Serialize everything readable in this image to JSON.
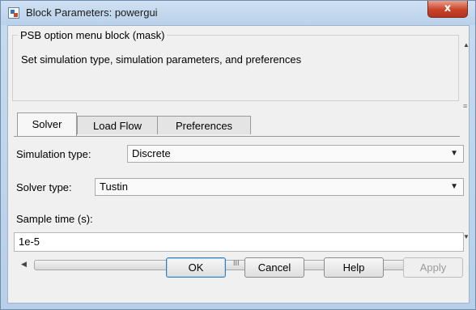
{
  "window": {
    "title": "Block Parameters: powergui",
    "close_label": "x"
  },
  "mask": {
    "legend": "PSB option menu block (mask)",
    "description": "Set simulation type, simulation parameters, and preferences"
  },
  "tabs": [
    {
      "label": "Solver",
      "active": true
    },
    {
      "label": "Load Flow",
      "active": false
    },
    {
      "label": "Preferences",
      "active": false
    }
  ],
  "solver": {
    "simulation_type_label": "Simulation type:",
    "simulation_type_value": "Discrete",
    "solver_type_label": "Solver type:",
    "solver_type_value": "Tustin",
    "sample_time_label": "Sample time (s):",
    "sample_time_value": "1e-5"
  },
  "scrollbar": {
    "grip": "III",
    "vgrip": "≡"
  },
  "buttons": {
    "ok": "OK",
    "cancel": "Cancel",
    "help": "Help",
    "apply": "Apply"
  }
}
